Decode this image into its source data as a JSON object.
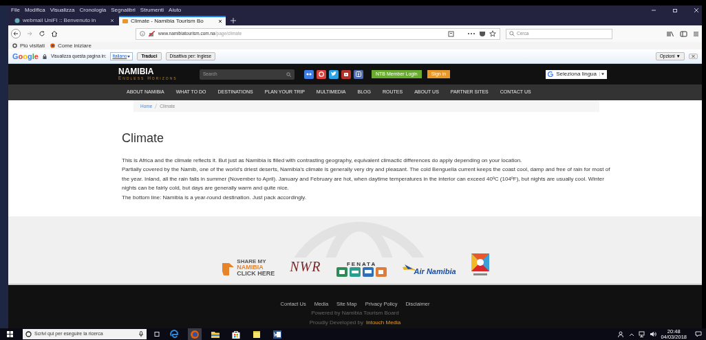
{
  "window": {
    "menu_bar": [
      "File",
      "Modifica",
      "Visualizza",
      "Cronologia",
      "Segnalibri",
      "Strumenti",
      "Aiuto"
    ]
  },
  "tabs": [
    {
      "title": "webmail UniFI :: Benvenuto in",
      "selected": false
    },
    {
      "title": "Climate - Namibia Tourism Bo",
      "selected": true
    }
  ],
  "address_bar": {
    "host": "www.namibiatourism.com.na",
    "path": "/page/climate"
  },
  "search_field": {
    "placeholder": "Cerca"
  },
  "bookmarks": [
    "Più visitati",
    "Come iniziare"
  ],
  "translate_bar": {
    "brand": "Google",
    "prompt": "Visualizza questa pagina in:",
    "language": "Italiano",
    "buttons": [
      "Traduci",
      "Disattiva per: Inglese"
    ],
    "options": "Opzioni ▼"
  },
  "site": {
    "logo": "NAMIBIA",
    "tagline": "Endless Horizons",
    "search_placeholder": "Search",
    "social": [
      {
        "kind": "flickr",
        "color": "#3d7de8"
      },
      {
        "kind": "pinterest",
        "color": "#d9413d"
      },
      {
        "kind": "twitter",
        "color": "#2aa3e8"
      },
      {
        "kind": "youtube",
        "color": "#b5322e"
      },
      {
        "kind": "facebook",
        "color": "#4f6db0"
      }
    ],
    "buttons": [
      {
        "label": "NTB Member Login",
        "color": "#6aac2e"
      },
      {
        "label": "Sign in",
        "color": "#e8982a"
      }
    ],
    "language_select": "Seleziona lingua",
    "nav": [
      "ABOUT NAMIBIA",
      "WHAT TO DO",
      "DESTINATIONS",
      "PLAN YOUR TRIP",
      "MULTIMEDIA",
      "BLOG",
      "ROUTES",
      "ABOUT US",
      "PARTNER SITES",
      "CONTACT US"
    ],
    "breadcrumb": [
      "Home",
      "Climate"
    ],
    "heading": "Climate",
    "paragraphs": [
      "This is Africa and the climate reflects it. But just as Namibia is filled with contrasting geography, equivalent climactic differences do apply depending on your location.",
      "Partially covered by the Namib, one of the world's driest deserts, Namibia's climate is generally very dry and pleasant. The cold Benguella current keeps the coast cool, damp and free of rain for most of the year. Inland, all the rain falls in summer (November to April). January and February are hot, when daytime temperatures in the interior can exceed 40ºC (104ºF), but nights are usually cool. Winter nights can be fairly cold, but days are generally warm and quite nice.",
      "The bottom line: Namibia is a year-round destination. Just pack accordingly."
    ],
    "partner_logos": [
      {
        "kind": "share",
        "lines": [
          "SHARE MY",
          "NAMIBIA",
          "CLICK HERE"
        ]
      },
      {
        "kind": "nwr",
        "lines": [
          "NWR"
        ]
      },
      {
        "kind": "fenata",
        "lines": [
          "FENATA"
        ]
      },
      {
        "kind": "airline",
        "lines": [
          "Air Namibia"
        ]
      },
      {
        "kind": "emblem"
      }
    ],
    "footer": {
      "links": [
        "Contact Us",
        "Media",
        "Site Map",
        "Privacy Policy",
        "Disclaimer"
      ],
      "powered": "Powered by Namibia Tourism Board",
      "developed": "Proudly Developed by",
      "developer": "Intouch Media"
    }
  },
  "taskbar": {
    "search_placeholder": "Scrivi qui per eseguire la ricerca",
    "apps": [
      {
        "kind": "edge",
        "selected": false
      },
      {
        "kind": "firefox",
        "selected": true
      },
      {
        "kind": "explorer",
        "selected": false
      },
      {
        "kind": "store",
        "selected": false
      },
      {
        "kind": "notes",
        "selected": false
      },
      {
        "kind": "word",
        "selected": false
      }
    ],
    "time": "20:48",
    "date": "04/03/2018"
  }
}
